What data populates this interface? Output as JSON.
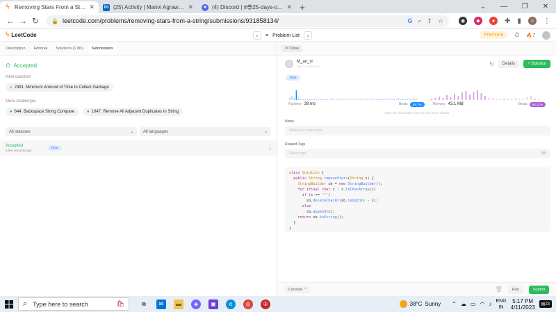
{
  "browser": {
    "tabs": [
      {
        "title": "Removing Stars From a String - Le",
        "icon": "leetcode-icon",
        "color": "#ffa116",
        "active": true
      },
      {
        "title": "(25) Activity | Manvi Agrawal | Lin",
        "icon": "linkedin-icon",
        "color": "#0a66c2",
        "active": false
      },
      {
        "title": "(4) Discord | #😎25-days-of-cod",
        "icon": "discord-icon",
        "color": "#5865f2",
        "active": false
      }
    ],
    "url": "leetcode.com/problems/removing-stars-from-a-string/submissions/931858134/"
  },
  "lcnav": {
    "logo": "LeetCode",
    "problem_list": "Problem List",
    "premium": "Premium",
    "streak": "7"
  },
  "left": {
    "tabs": [
      "Description",
      "Editorial",
      "Solutions (1.8K)",
      "Submissions"
    ],
    "status": "Accepted",
    "next_question_label": "Next question",
    "next_question": "2391. Minimum Amount of Time to Collect Garbage",
    "more_challenges_label": "More challenges",
    "challenges": [
      "844. Backspace String Compare",
      "1047. Remove All Adjacent Duplicates In String"
    ],
    "filter_status": "All statuses",
    "filter_lang": "All languages",
    "submission": {
      "status": "Accepted",
      "time": "a few seconds ago",
      "lang": "Java"
    }
  },
  "right": {
    "close": "Close",
    "author": "M_an_vi",
    "date": "Apr 11, 2023 17:17",
    "details_btn": "Details",
    "solution_btn": "+ Solution",
    "lang": "Java",
    "runtime_label": "Runtime",
    "runtime_value": "39 ms",
    "beats_label": "Beats",
    "runtime_beats": "89.7%",
    "memory_label": "Memory",
    "memory_value": "43.1 MB",
    "memory_beats": "94.12%",
    "hint": "Click the distribution chart to view more details",
    "notes_label": "Notes",
    "notes_placeholder": "Write your notes here",
    "tags_label": "Related Tags",
    "tags_placeholder": "Select tags",
    "tags_count": "0/5",
    "console": "Console",
    "run": "Run",
    "submit": "Submit"
  },
  "taskbar": {
    "search_placeholder": "Type here to search",
    "temp": "38°C",
    "weather": "Sunny",
    "lang1": "ENG",
    "lang2": "IN",
    "time": "5:17 PM",
    "date": "4/11/2023",
    "notif_count": "23"
  },
  "colors": {
    "accent": "#2cbb5d",
    "brand": "#ffa116",
    "runtime_pill": "#1a90ff",
    "memory_pill": "#b35cd6"
  }
}
